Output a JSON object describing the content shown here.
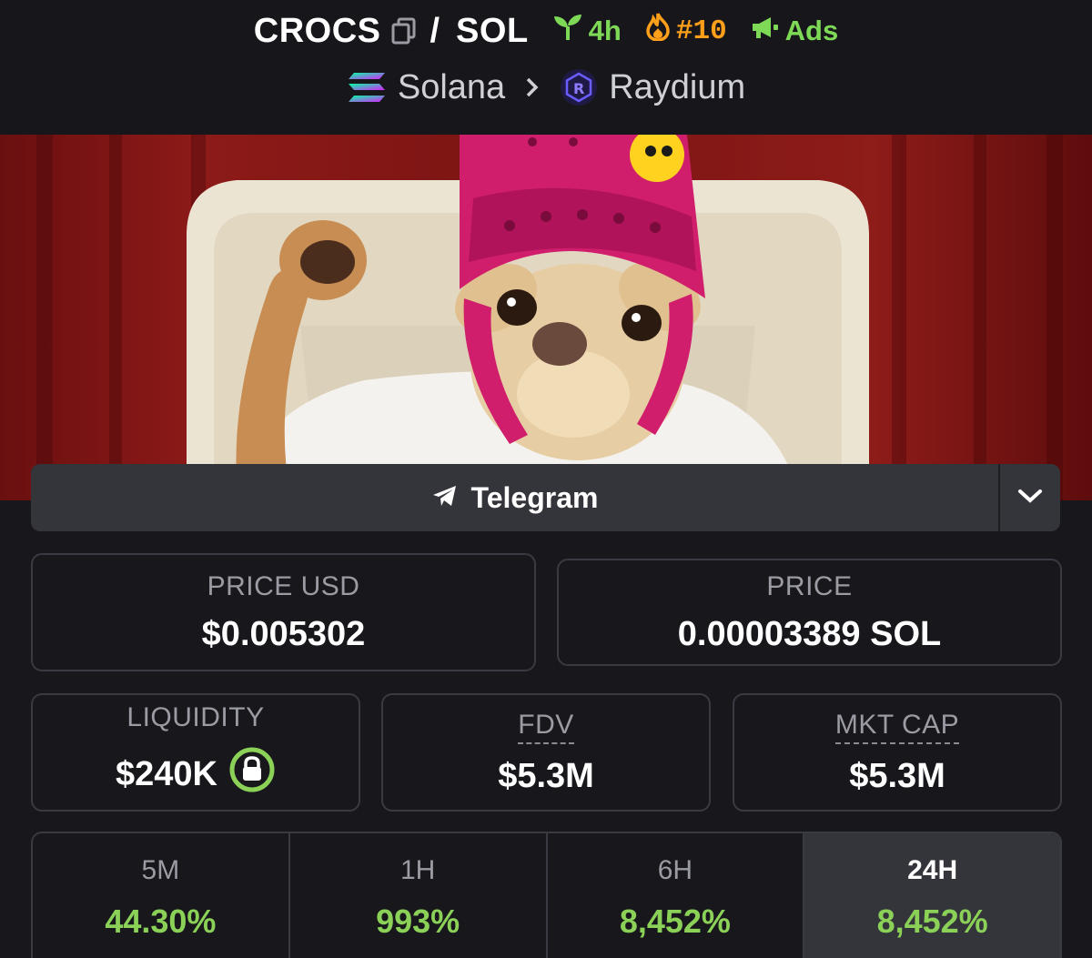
{
  "header": {
    "base_symbol": "CROCS",
    "separator": "/",
    "quote_symbol": "SOL",
    "badges": {
      "age": "4h",
      "rank": "#10",
      "ads": "Ads"
    },
    "chain": "Solana",
    "dex": "Raydium"
  },
  "banner": {
    "icon": "meme-chihuahua-image"
  },
  "social": {
    "telegram_label": "Telegram"
  },
  "stats": {
    "price_usd_label": "PRICE USD",
    "price_usd_value": "$0.005302",
    "price_label": "PRICE",
    "price_value": "0.00003389 SOL",
    "liquidity_label": "LIQUIDITY",
    "liquidity_value": "$240K",
    "fdv_label": "FDV",
    "fdv_value": "$5.3M",
    "mktcap_label": "MKT CAP",
    "mktcap_value": "$5.3M"
  },
  "timeframes": [
    {
      "label": "5M",
      "value": "44.30%"
    },
    {
      "label": "1H",
      "value": "993%"
    },
    {
      "label": "6H",
      "value": "8,452%"
    },
    {
      "label": "24H",
      "value": "8,452%"
    }
  ],
  "colors": {
    "background": "#17171c",
    "positive": "#8bd158",
    "age_badge": "#7ed957",
    "rank_badge": "#ff9f1a",
    "card_border": "#3a3a42",
    "button_bg": "#34343b"
  }
}
